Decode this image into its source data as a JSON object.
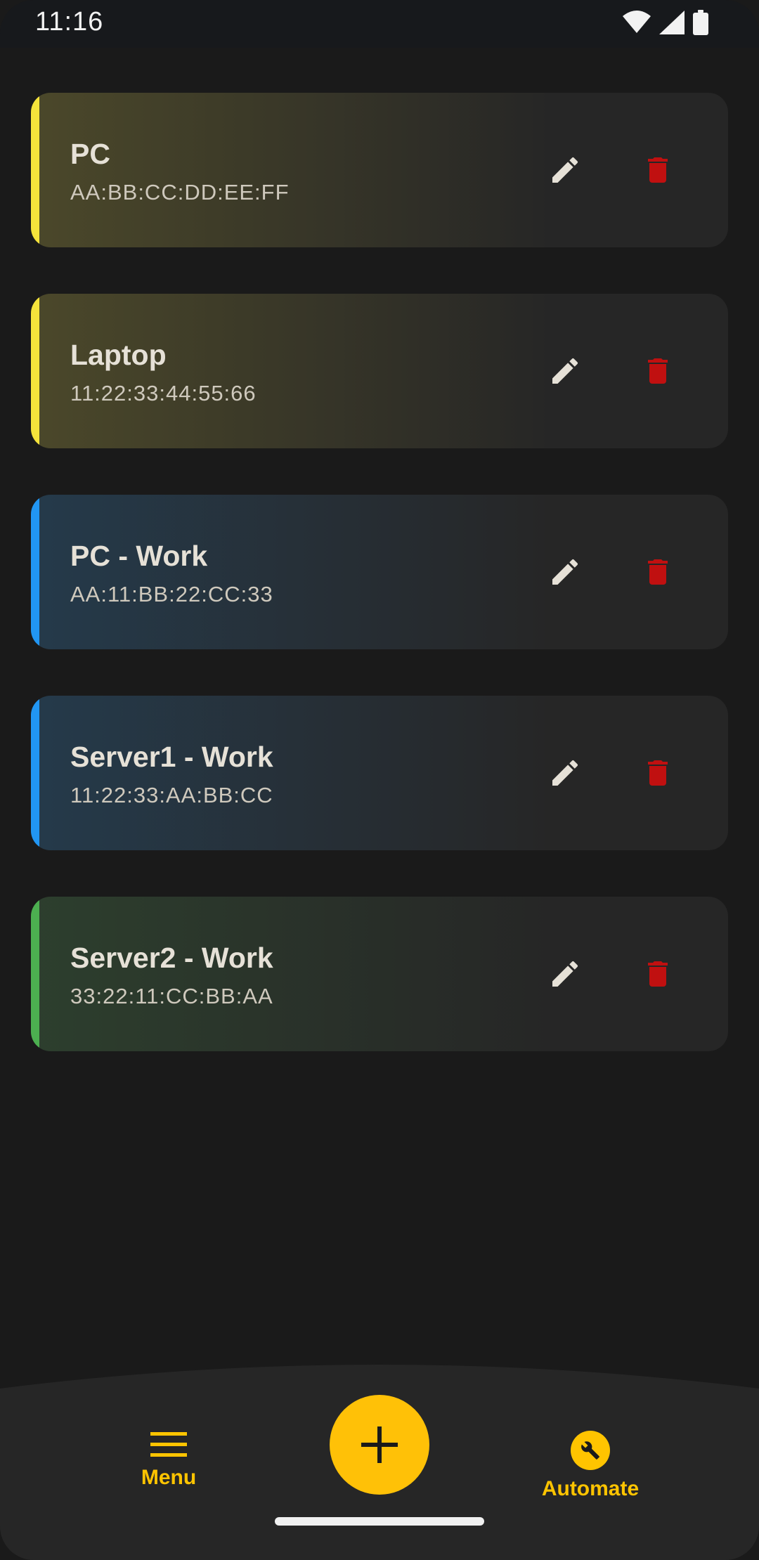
{
  "status_bar": {
    "time": "11:16",
    "icons": [
      "wifi-icon",
      "signal-icon",
      "battery-icon"
    ]
  },
  "devices": [
    {
      "name": "PC",
      "mac": "AA:BB:CC:DD:EE:FF",
      "color": "#f5e33b"
    },
    {
      "name": "Laptop",
      "mac": "11:22:33:44:55:66",
      "color": "#f5e33b"
    },
    {
      "name": "PC - Work",
      "mac": "AA:11:BB:22:CC:33",
      "color": "#2196f3"
    },
    {
      "name": "Server1 - Work",
      "mac": "11:22:33:AA:BB:CC",
      "color": "#2196f3"
    },
    {
      "name": "Server2 - Work",
      "mac": "33:22:11:CC:BB:AA",
      "color": "#4caf50"
    }
  ],
  "bottom_nav": {
    "menu_label": "Menu",
    "automate_label": "Automate",
    "fab_icon": "plus-icon"
  },
  "colors": {
    "accent": "#ffc107",
    "delete": "#c01010",
    "edit": "#e6e1d7",
    "background": "#1a1a1a",
    "card": "#262626"
  }
}
